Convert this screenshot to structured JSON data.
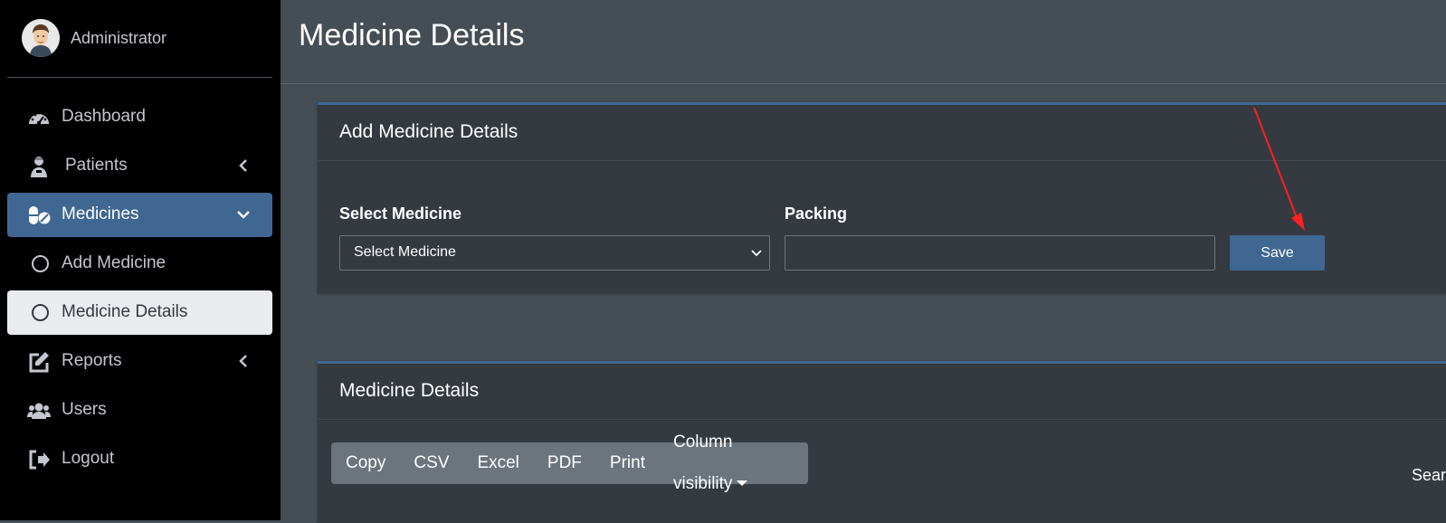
{
  "user": {
    "name": "Administrator"
  },
  "nav": {
    "items": [
      {
        "label": "Dashboard"
      },
      {
        "label": "Patients"
      },
      {
        "label": "Medicines"
      },
      {
        "label": "Add Medicine"
      },
      {
        "label": "Medicine Details"
      },
      {
        "label": "Reports"
      },
      {
        "label": "Users"
      },
      {
        "label": "Logout"
      }
    ]
  },
  "page": {
    "title": "Medicine Details"
  },
  "add_card": {
    "title": "Add Medicine Details",
    "select_label": "Select Medicine",
    "select_value": "Select Medicine",
    "packing_label": "Packing",
    "packing_value": "",
    "save_label": "Save"
  },
  "details_card": {
    "title": "Medicine Details",
    "buttons": [
      "Copy",
      "CSV",
      "Excel",
      "PDF",
      "Print",
      "Column visibility"
    ],
    "search_label": "Search:"
  },
  "colors": {
    "accent": "#3f6791",
    "sidebar": "#000000",
    "content": "#454d55",
    "card": "#343a40",
    "annotation": "#ff2020"
  }
}
